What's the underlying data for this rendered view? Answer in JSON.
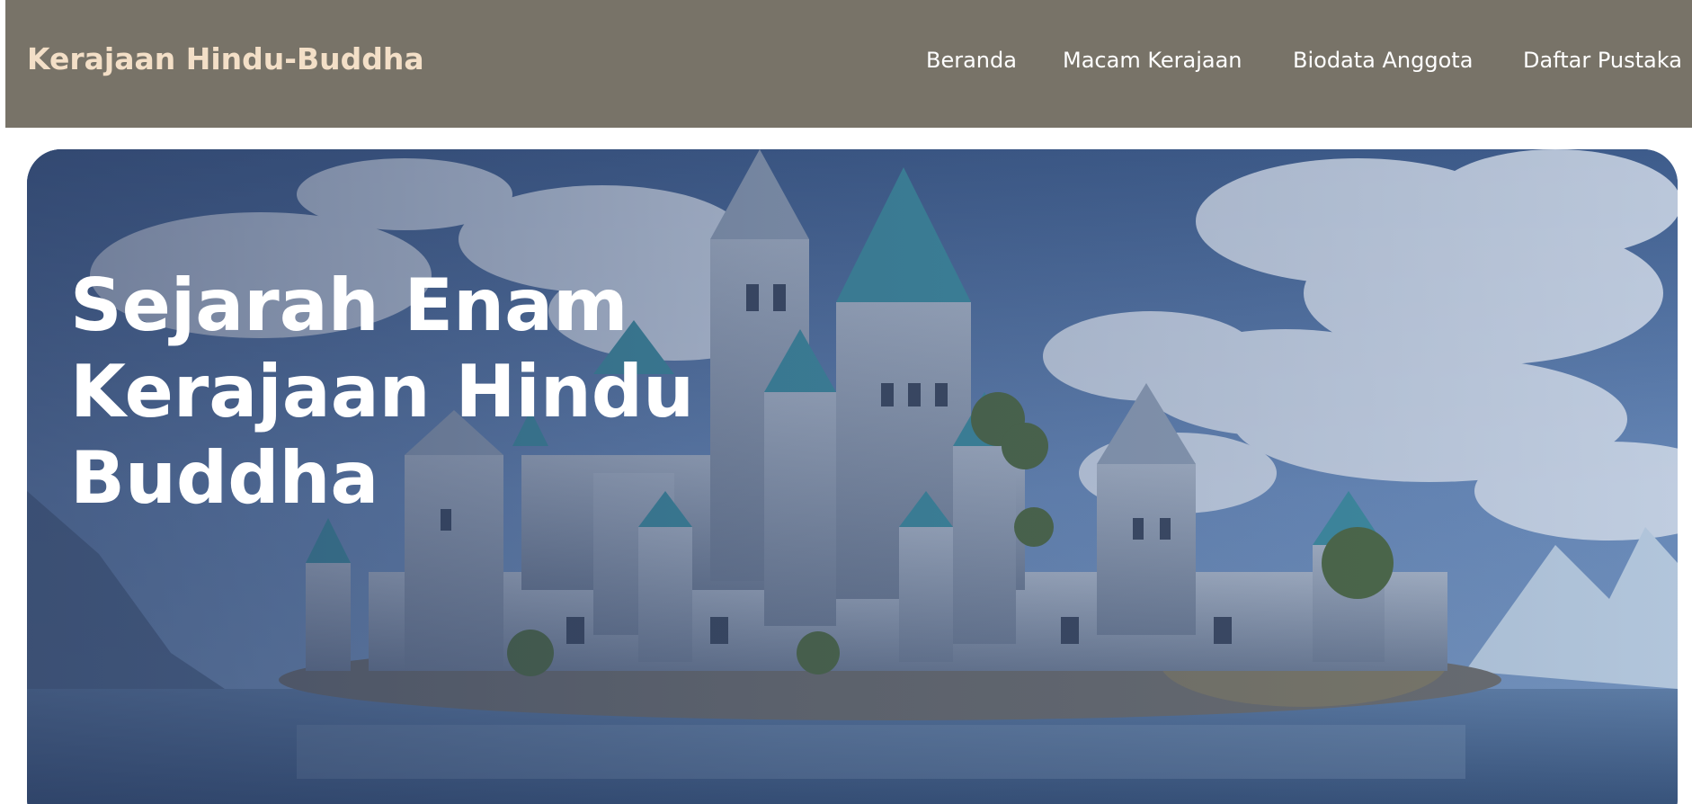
{
  "header": {
    "brand": "Kerajaan Hindu-Buddha",
    "nav": [
      {
        "label": "Beranda"
      },
      {
        "label": "Macam Kerajaan"
      },
      {
        "label": "Biodata Anggota"
      },
      {
        "label": "Daftar Pustaka"
      }
    ]
  },
  "hero": {
    "title": "Sejarah Enam Kerajaan Hindu Buddha",
    "image": "fairytale castle on an island surrounded by water, clouds and snowy mountains"
  },
  "colors": {
    "navbar_bg": "#787368",
    "brand_text": "#f3dfc7",
    "nav_text": "#ffffff",
    "hero_title": "#ffffff"
  }
}
